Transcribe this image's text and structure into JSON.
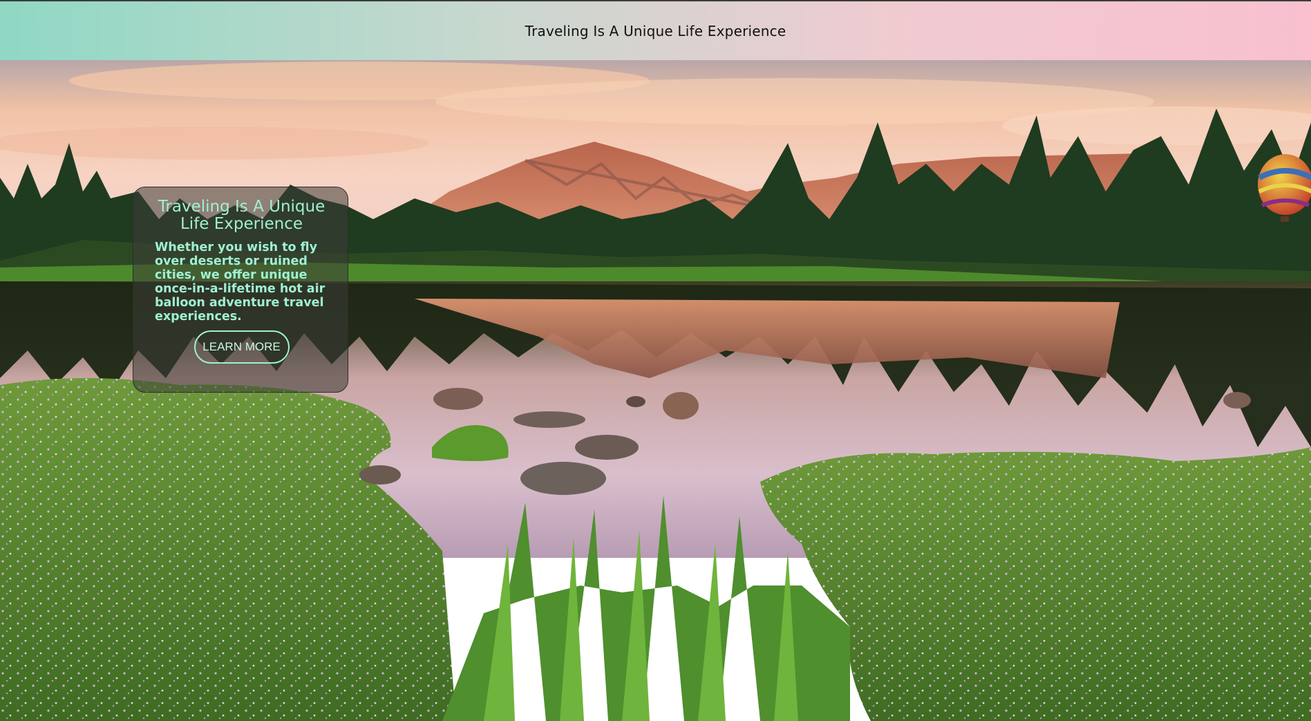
{
  "header": {
    "title": "Traveling Is A Unique Life Experience"
  },
  "hero": {
    "image": "mountain lake landscape with pine trees, wildflowers and a hot air balloon",
    "card": {
      "title": "Traveling Is A Unique Life Experience",
      "text": "Whether you wish to fly over deserts or ruined cities, we offer unique once-in-a-lifetime hot air balloon adventure travel experiences.",
      "button_label": "LEARN MORE"
    }
  },
  "colors": {
    "header_gradient_start": "#8fd8c4",
    "header_gradient_end": "#f9c0cf",
    "accent_text": "#9ff0d2",
    "card_background": "#3c3c37"
  }
}
